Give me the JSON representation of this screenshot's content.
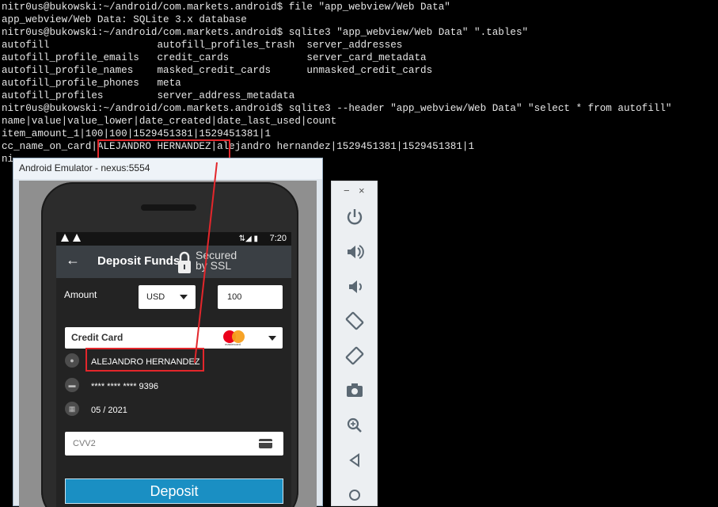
{
  "terminal": {
    "lines": [
      "nitr0us@bukowski:~/android/com.markets.android$ file \"app_webview/Web Data\"",
      "app_webview/Web Data: SQLite 3.x database",
      "nitr0us@bukowski:~/android/com.markets.android$ sqlite3 \"app_webview/Web Data\" \".tables\"",
      "autofill                  autofill_profiles_trash  server_addresses",
      "autofill_profile_emails   credit_cards             server_card_metadata",
      "autofill_profile_names    masked_credit_cards      unmasked_credit_cards",
      "autofill_profile_phones   meta",
      "autofill_profiles         server_address_metadata",
      "nitr0us@bukowski:~/android/com.markets.android$ sqlite3 --header \"app_webview/Web Data\" \"select * from autofill\"",
      "name|value|value_lower|date_created|date_last_used|count",
      "item_amount_1|100|100|1529451381|1529451381|1",
      "cc_name_on_card|ALEJANDRO HERNANDEZ|alejandro hernandez|1529451381|1529451381|1",
      "ni"
    ]
  },
  "emulator": {
    "title": "Android Emulator - nexus:5554"
  },
  "statusbar": {
    "time": "7:20"
  },
  "app": {
    "title": "Deposit Funds",
    "ssl_line1": "Secured",
    "ssl_line2": "by SSL",
    "amount_label": "Amount",
    "currency": "USD",
    "amount_value": "100",
    "payment_method": "Credit Card",
    "mastercard_label": "mastercard",
    "cardholder_name": "ALEJANDRO HERNANDEZ",
    "card_number": "**** **** **** 9396",
    "expiry": "05 / 2021",
    "cvv_placeholder": "CVV2",
    "deposit_label": "Deposit"
  },
  "colors": {
    "highlight": "#e3262b",
    "deposit_button": "#1a8fc3",
    "app_bar": "#3a3f44"
  },
  "toolbar_icons": [
    "power-icon",
    "volume-up-icon",
    "volume-down-icon",
    "rotate-left-icon",
    "rotate-right-icon",
    "camera-icon",
    "zoom-icon",
    "back-icon",
    "home-icon"
  ]
}
